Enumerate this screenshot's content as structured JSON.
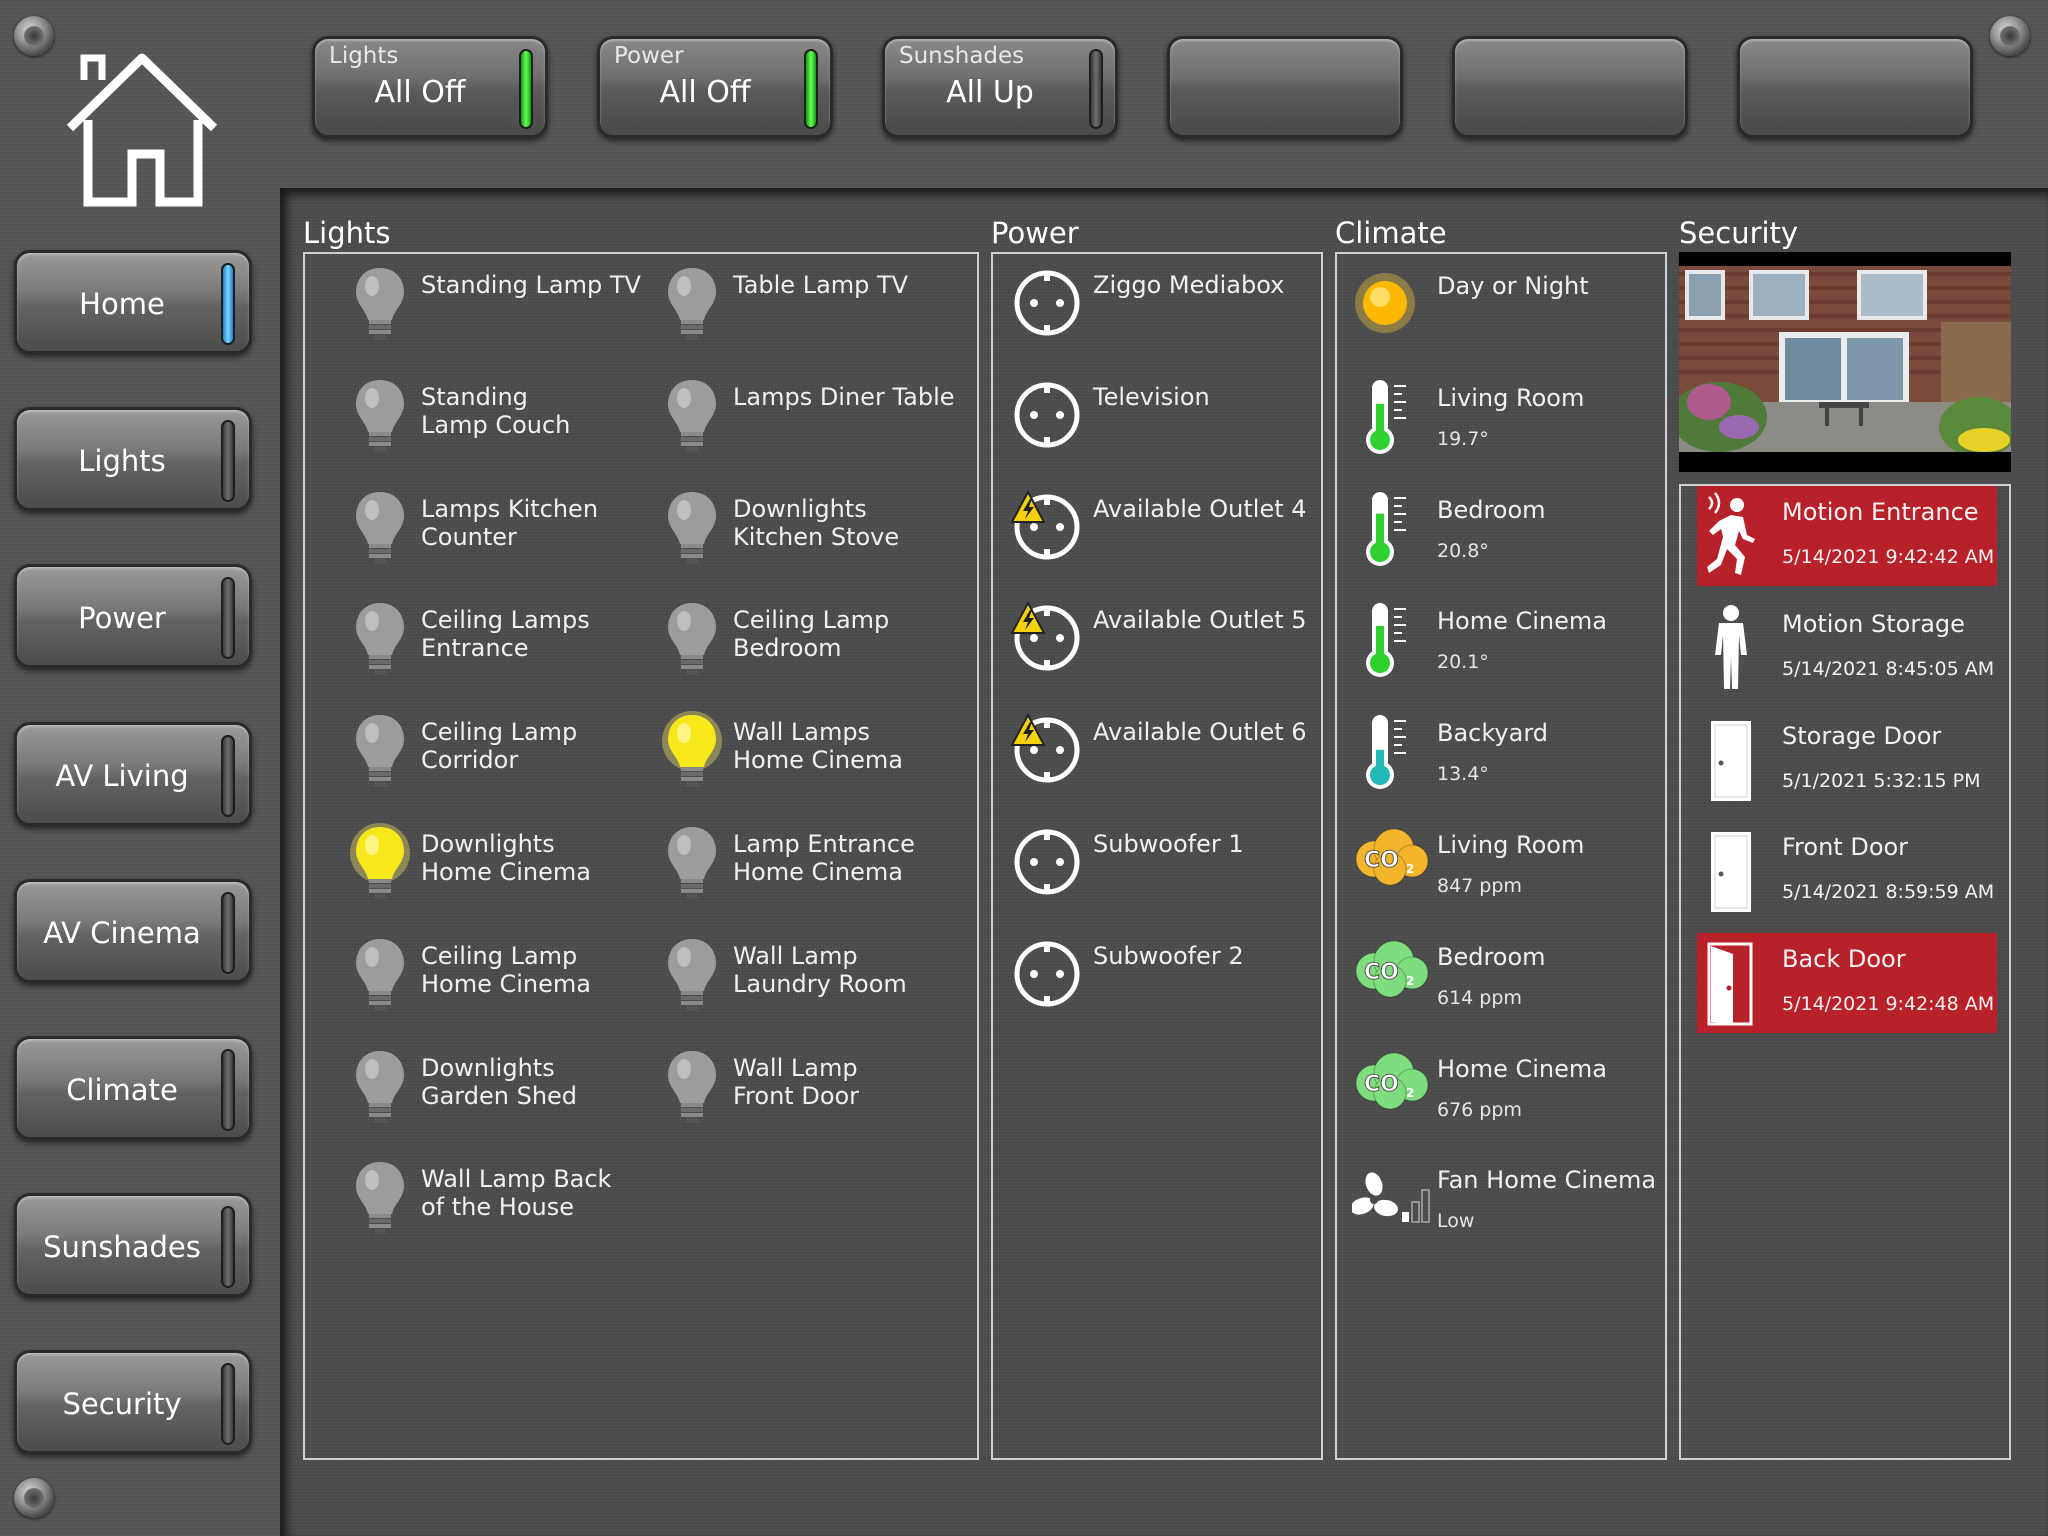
{
  "top_buttons": [
    {
      "small": "Lights",
      "main": "All Off",
      "indicator": "green"
    },
    {
      "small": "Power",
      "main": "All Off",
      "indicator": "green"
    },
    {
      "small": "Sunshades",
      "main": "All Up",
      "indicator": "off"
    },
    {
      "small": "",
      "main": "",
      "indicator": "none"
    },
    {
      "small": "",
      "main": "",
      "indicator": "none"
    },
    {
      "small": "",
      "main": "",
      "indicator": "none"
    }
  ],
  "nav": [
    {
      "label": "Home",
      "indicator": "blue"
    },
    {
      "label": "Lights",
      "indicator": "off"
    },
    {
      "label": "Power",
      "indicator": "off"
    },
    {
      "label": "AV Living",
      "indicator": "off"
    },
    {
      "label": "AV Cinema",
      "indicator": "off"
    },
    {
      "label": "Climate",
      "indicator": "off"
    },
    {
      "label": "Sunshades",
      "indicator": "off"
    },
    {
      "label": "Security",
      "indicator": "off"
    }
  ],
  "sections": {
    "lights": "Lights",
    "power": "Power",
    "climate": "Climate",
    "security": "Security"
  },
  "lights": [
    {
      "line1": "Standing Lamp TV",
      "line2": "",
      "on": false,
      "icon": "lightbulb-icon"
    },
    {
      "line1": "Table Lamp TV",
      "line2": "",
      "on": false,
      "icon": "lightbulb-icon"
    },
    {
      "line1": "Standing",
      "line2": "Lamp Couch",
      "on": false,
      "icon": "lightbulb-icon"
    },
    {
      "line1": "Lamps Diner Table",
      "line2": "",
      "on": false,
      "icon": "lightbulb-icon"
    },
    {
      "line1": "Lamps Kitchen",
      "line2": "Counter",
      "on": false,
      "icon": "lightbulb-icon"
    },
    {
      "line1": "Downlights",
      "line2": "Kitchen Stove",
      "on": false,
      "icon": "lightbulb-icon"
    },
    {
      "line1": "Ceiling Lamps",
      "line2": "Entrance",
      "on": false,
      "icon": "lightbulb-icon"
    },
    {
      "line1": "Ceiling Lamp",
      "line2": "Bedroom",
      "on": false,
      "icon": "lightbulb-icon"
    },
    {
      "line1": "Ceiling Lamp",
      "line2": "Corridor",
      "on": false,
      "icon": "lightbulb-icon"
    },
    {
      "line1": "Wall Lamps",
      "line2": "Home Cinema",
      "on": true,
      "icon": "lightbulb-icon"
    },
    {
      "line1": "Downlights",
      "line2": "Home Cinema",
      "on": true,
      "icon": "lightbulb-icon"
    },
    {
      "line1": "Lamp Entrance",
      "line2": "Home Cinema",
      "on": false,
      "icon": "lightbulb-icon"
    },
    {
      "line1": "Ceiling Lamp",
      "line2": "Home Cinema",
      "on": false,
      "icon": "lightbulb-icon"
    },
    {
      "line1": "Wall Lamp",
      "line2": "Laundry Room",
      "on": false,
      "icon": "lightbulb-icon"
    },
    {
      "line1": "Downlights",
      "line2": "Garden Shed",
      "on": false,
      "icon": "lightbulb-icon"
    },
    {
      "line1": "Wall Lamp",
      "line2": "Front Door",
      "on": false,
      "icon": "lightbulb-icon"
    },
    {
      "line1": "Wall Lamp Back",
      "line2": "of the House",
      "on": false,
      "icon": "lightbulb-icon"
    }
  ],
  "power": [
    {
      "label": "Ziggo Mediabox",
      "warning": false,
      "icon": "power-outlet-icon"
    },
    {
      "label": "Television",
      "warning": false,
      "icon": "power-outlet-icon"
    },
    {
      "label": "Available Outlet 4",
      "warning": true,
      "icon": "power-outlet-icon"
    },
    {
      "label": "Available Outlet 5",
      "warning": true,
      "icon": "power-outlet-icon"
    },
    {
      "label": "Available Outlet 6",
      "warning": true,
      "icon": "power-outlet-icon"
    },
    {
      "label": "Subwoofer 1",
      "warning": false,
      "icon": "power-outlet-icon"
    },
    {
      "label": "Subwoofer 2",
      "warning": false,
      "icon": "power-outlet-icon"
    }
  ],
  "climate": [
    {
      "label": "Day or Night",
      "value": "",
      "type": "sun"
    },
    {
      "label": "Living Room",
      "value": "19.7°",
      "type": "thermo",
      "fill": 0.55,
      "color": "#2ed12e"
    },
    {
      "label": "Bedroom",
      "value": "20.8°",
      "type": "thermo",
      "fill": 0.6,
      "color": "#2ed12e"
    },
    {
      "label": "Home Cinema",
      "value": "20.1°",
      "type": "thermo",
      "fill": 0.57,
      "color": "#2ed12e"
    },
    {
      "label": "Backyard",
      "value": "13.4°",
      "type": "thermo",
      "fill": 0.3,
      "color": "#22b8b8"
    },
    {
      "label": "Living Room",
      "value": "847 ppm",
      "type": "co2",
      "color": "#f3b52c"
    },
    {
      "label": "Bedroom",
      "value": "614 ppm",
      "type": "co2",
      "color": "#7ede7e"
    },
    {
      "label": "Home Cinema",
      "value": "676 ppm",
      "type": "co2",
      "color": "#7ede7e"
    },
    {
      "label": "Fan Home Cinema",
      "value": "Low",
      "type": "fan"
    }
  ],
  "co2_label": "CO",
  "co2_sub": "2",
  "security": [
    {
      "label": "Motion Entrance",
      "time": "5/14/2021 9:42:42 AM",
      "alert": true,
      "type": "motion"
    },
    {
      "label": "Motion Storage",
      "time": "5/14/2021 8:45:05 AM",
      "alert": false,
      "type": "person"
    },
    {
      "label": "Storage Door",
      "time": "5/1/2021 5:32:15 PM",
      "alert": false,
      "type": "door"
    },
    {
      "label": "Front Door",
      "time": "5/14/2021 8:59:59 AM",
      "alert": false,
      "type": "door"
    },
    {
      "label": "Back Door",
      "time": "5/14/2021 9:42:48 AM",
      "alert": true,
      "type": "door-open"
    }
  ],
  "colors": {
    "alert_red": "#b8202a",
    "bulb_on": "#f7e81a",
    "bulb_off": "#9a9a9a",
    "warning": "#f5d10a"
  }
}
